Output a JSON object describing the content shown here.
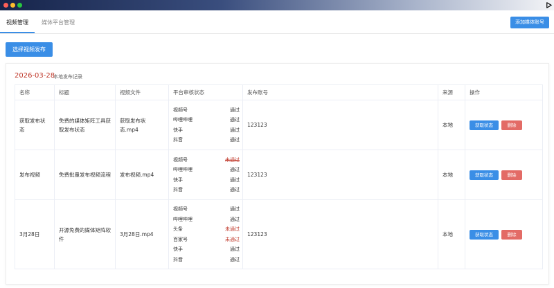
{
  "tabs": [
    {
      "label": "视频管理",
      "active": true
    },
    {
      "label": "媒体平台管理",
      "active": false
    }
  ],
  "toolbar": {
    "add_account_label": "添加媒体账号",
    "choose_publish_label": "选择视频发布"
  },
  "record": {
    "date": "2026-03-28",
    "label": "本地发布记录"
  },
  "table": {
    "headers": [
      "名称",
      "标题",
      "视频文件",
      "平台审核状态",
      "发布账号",
      "来源",
      "操作"
    ],
    "rows": [
      {
        "name": "获取发布状态",
        "title": "免费的媒体矩阵工具获取发布状态",
        "file": "获取发布状态.mp4",
        "platforms": [
          {
            "name": "视频号",
            "status": "通过"
          },
          {
            "name": "哔哩哔哩",
            "status": "通过"
          },
          {
            "name": "快手",
            "status": "通过"
          },
          {
            "name": "抖音",
            "status": "通过"
          }
        ],
        "account": "123123",
        "source": "本地"
      },
      {
        "name": "发布视频",
        "title": "免费批量发布视频流程",
        "file": "发布视频.mp4",
        "platforms": [
          {
            "name": "视频号",
            "status": "未通过"
          },
          {
            "name": "哔哩哔哩",
            "status": "通过"
          },
          {
            "name": "快手",
            "status": "通过"
          },
          {
            "name": "抖音",
            "status": "通过"
          }
        ],
        "account": "123123",
        "source": "本地"
      },
      {
        "name": "3月28日",
        "title": "开源免费的媒体矩阵软件",
        "file": "3月28日.mp4",
        "platforms": [
          {
            "name": "视频号",
            "status": "通过"
          },
          {
            "name": "哔哩哔哩",
            "status": "通过"
          },
          {
            "name": "头条",
            "status": "未通过"
          },
          {
            "name": "百家号",
            "status": "未通过"
          },
          {
            "name": "快手",
            "status": "通过"
          },
          {
            "name": "抖音",
            "status": "通过"
          }
        ],
        "account": "123123",
        "source": "本地"
      }
    ],
    "actions": {
      "get_status": "获取状态",
      "delete": "删除"
    }
  },
  "colors": {
    "accent": "#3a8ee6",
    "danger": "#e36b66",
    "fail_text": "#c0392b"
  }
}
